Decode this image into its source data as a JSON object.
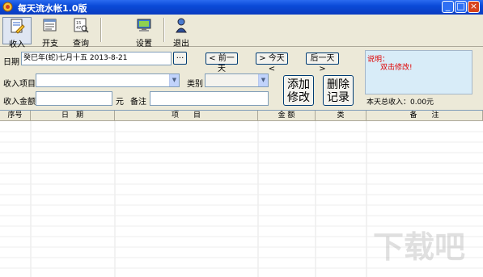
{
  "window": {
    "title": "每天流水帐1.0版",
    "controls": [
      "_",
      "□",
      "×"
    ]
  },
  "toolbar": {
    "items": [
      {
        "label": "收入",
        "icon": "income-icon"
      },
      {
        "label": "开支",
        "icon": "expense-icon"
      },
      {
        "label": "查询",
        "icon": "query-icon"
      },
      {
        "label": "设置",
        "icon": "settings-icon"
      },
      {
        "label": "退出",
        "icon": "exit-icon"
      }
    ]
  },
  "form": {
    "date_label": "日期",
    "date_value": "癸巳年(蛇)七月十五 2013-8-21",
    "date_picker": "...",
    "prev_day": "< 前一天",
    "today": "> 今天 <",
    "next_day": "后一天 >",
    "item_label": "收入项目",
    "item_value": "",
    "category_label": "类别",
    "category_value": "",
    "amount_label": "收入金额",
    "amount_value": "",
    "unit": "元",
    "remark_label": "备注",
    "remark_value": "",
    "add_button": [
      "添加",
      "修改"
    ],
    "delete_button": [
      "删除",
      "记录"
    ]
  },
  "note": {
    "title": "说明：",
    "text": "双击修改!"
  },
  "total": "本天总收入：0.00元",
  "table": {
    "columns": [
      "序号",
      "日　期",
      "项　　目",
      "金 额",
      "类",
      "备　　注"
    ],
    "rows": []
  },
  "watermark": "下载吧"
}
